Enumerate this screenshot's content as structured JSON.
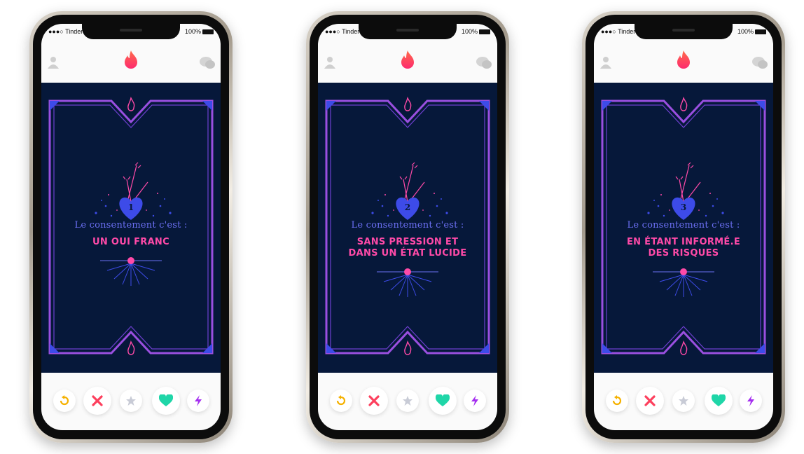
{
  "status_bar": {
    "carrier": "●●●○ Tinder",
    "battery": "100%"
  },
  "card_title": "Le consentement c'est :",
  "screens": [
    {
      "number": "1",
      "lines": [
        "UN OUI FRANC",
        ""
      ]
    },
    {
      "number": "2",
      "lines": [
        "SANS PRESSION ET",
        "DANS UN ÉTAT LUCIDE"
      ]
    },
    {
      "number": "3",
      "lines": [
        "EN ÉTANT INFORMÉ.E",
        "DES RISQUES"
      ]
    }
  ],
  "colors": {
    "card_bg": "#06183a",
    "frame": "#9a4fe0",
    "accent_blue": "#3d4be8",
    "pink": "#ff4aa8",
    "tinder": "#fd5068"
  },
  "icons": {
    "profile": "profile-icon",
    "logo": "tinder-flame-icon",
    "messages": "chat-icon",
    "rewind": "rewind-icon",
    "nope": "close-icon",
    "superlike": "star-icon",
    "like": "heart-icon",
    "boost": "bolt-icon"
  }
}
